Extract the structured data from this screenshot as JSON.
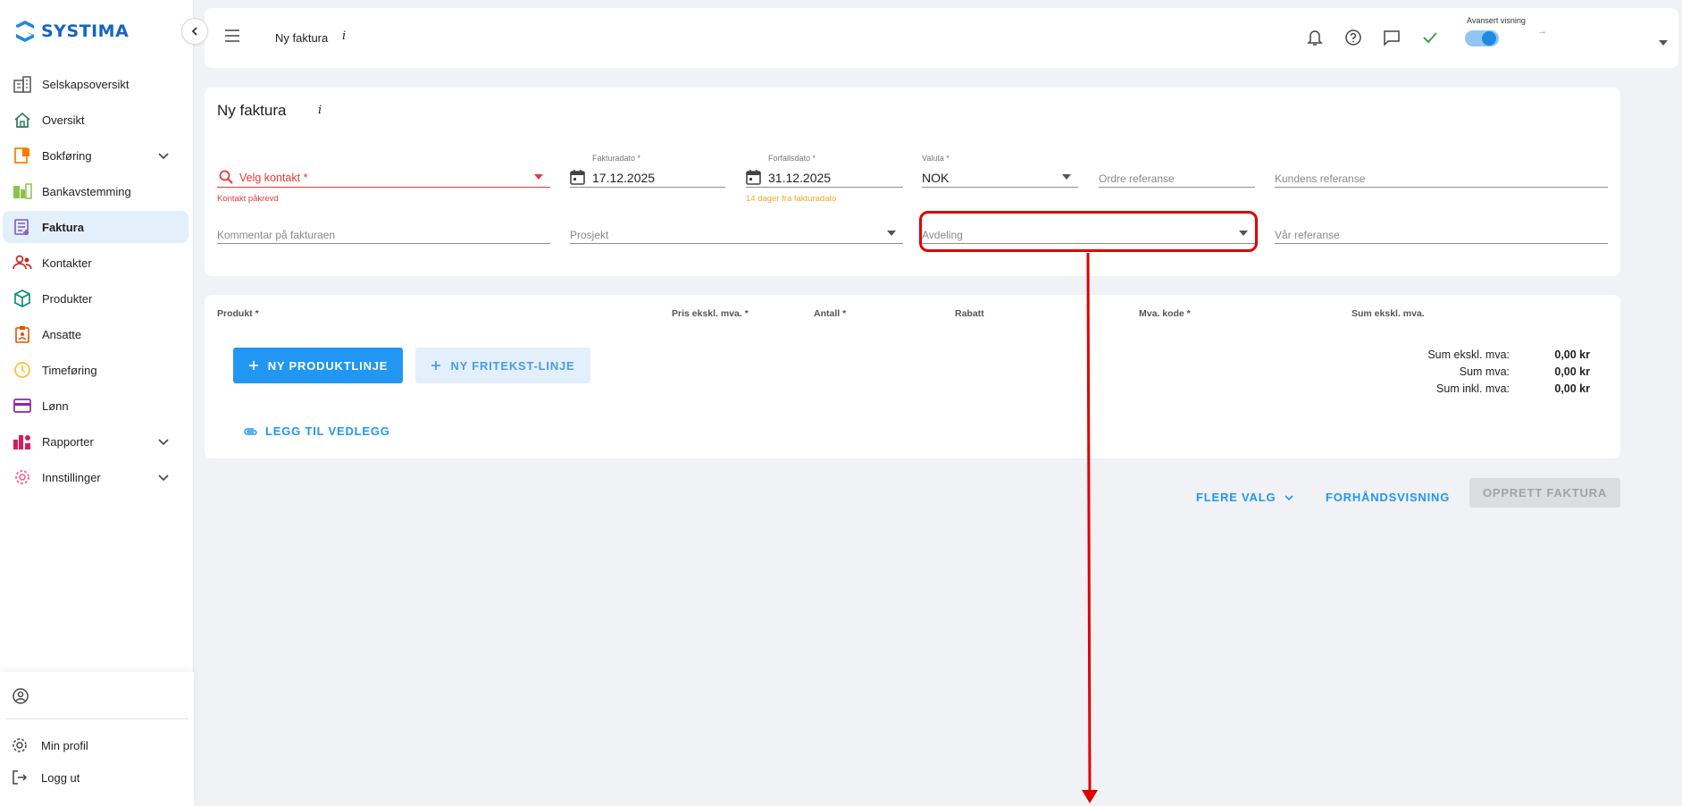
{
  "brand": {
    "name": "SYSTIMA"
  },
  "sidebar": {
    "items": [
      {
        "label": "Selskapsoversikt",
        "icon": "building-icon",
        "color": "#555555",
        "chevron": false,
        "active": false
      },
      {
        "label": "Oversikt",
        "icon": "home-icon",
        "color": "#2e7d5b",
        "chevron": false,
        "active": false
      },
      {
        "label": "Bokføring",
        "icon": "ledger-icon",
        "color": "#f57c00",
        "chevron": true,
        "active": false
      },
      {
        "label": "Bankavstemming",
        "icon": "bank-icon",
        "color": "#8bc34a",
        "chevron": false,
        "active": false
      },
      {
        "label": "Faktura",
        "icon": "invoice-icon",
        "color": "#7e57c2",
        "chevron": false,
        "active": true
      },
      {
        "label": "Kontakter",
        "icon": "contacts-icon",
        "color": "#c62828",
        "chevron": false,
        "active": false
      },
      {
        "label": "Produkter",
        "icon": "box-icon",
        "color": "#00897b",
        "chevron": false,
        "active": false
      },
      {
        "label": "Ansatte",
        "icon": "badge-icon",
        "color": "#e65100",
        "chevron": false,
        "active": false
      },
      {
        "label": "Timeføring",
        "icon": "clock-icon",
        "color": "#fbc02d",
        "chevron": false,
        "active": false
      },
      {
        "label": "Lønn",
        "icon": "card-icon",
        "color": "#8e24aa",
        "chevron": false,
        "active": false
      },
      {
        "label": "Rapporter",
        "icon": "report-icon",
        "color": "#d81b60",
        "chevron": true,
        "active": false
      },
      {
        "label": "Innstillinger",
        "icon": "gear-icon",
        "color": "#f06292",
        "chevron": true,
        "active": false
      }
    ],
    "bottom": {
      "profile": "Min profil",
      "logout": "Logg ut"
    }
  },
  "topbar": {
    "title": "Ny faktura",
    "info": "i",
    "advanced_label": "Avansert visning",
    "advanced_on": true,
    "arrow": "→"
  },
  "form": {
    "title": "Ny faktura",
    "info": "i",
    "contact": {
      "placeholder": "Velg kontakt *",
      "error": "Kontakt påkrevd"
    },
    "invoice_date": {
      "label": "Fakturadato *",
      "value": "17.12.2025"
    },
    "due_date": {
      "label": "Forfallsdato *",
      "value": "31.12.2025",
      "hint": "14 dager fra fakturadato"
    },
    "currency": {
      "label": "Valuta *",
      "value": "NOK"
    },
    "order_ref": {
      "placeholder": "Ordre referanse"
    },
    "customer_ref": {
      "placeholder": "Kundens referanse"
    },
    "comment": {
      "placeholder": "Kommentar på fakturaen"
    },
    "project": {
      "placeholder": "Prosjekt"
    },
    "department": {
      "placeholder": "Avdeling"
    },
    "our_ref": {
      "placeholder": "Vår referanse"
    }
  },
  "lines": {
    "columns": [
      "Produkt *",
      "Pris ekskl. mva. *",
      "Antall *",
      "Rabatt",
      "Mva. kode *",
      "Sum ekskl. mva."
    ],
    "add_product": "NY PRODUKTLINJE",
    "add_freetext": "NY FRITEKST-LINJE",
    "add_attachment": "LEGG TIL VEDLEGG",
    "sums": [
      {
        "label": "Sum ekskl. mva:",
        "value": "0,00 kr"
      },
      {
        "label": "Sum mva:",
        "value": "0,00 kr"
      },
      {
        "label": "Sum inkl. mva:",
        "value": "0,00 kr"
      }
    ]
  },
  "actions": {
    "more": "FLERE VALG",
    "preview": "FORHÅNDSVISNING",
    "create": "OPPRETT FAKTURA"
  },
  "colors": {
    "primary": "#2196f3",
    "error": "#e53935",
    "warning": "#f5a623",
    "annotation": "#e00000"
  }
}
